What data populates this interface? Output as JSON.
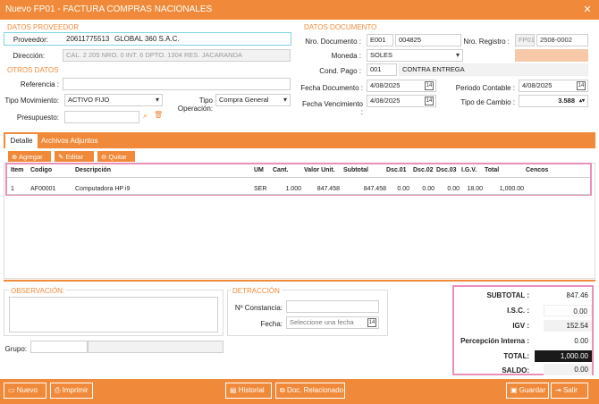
{
  "window": {
    "title": "Nuevo FP01 - FACTURA COMPRAS NACIONALES"
  },
  "proveedor": {
    "section": "DATOS PROVEEDOR",
    "label_proveedor": "Proveedor:",
    "ruc": "20611775513",
    "nombre": "GLOBAL 360 S.A.C.",
    "label_direccion": "Dirección:",
    "direccion": "CAL. 2 205 NRO. 0 INT. 6 DPTO. 1304 RES. JACARANDA"
  },
  "otros": {
    "section": "OTROS DATOS",
    "label_referencia": "Referencia :",
    "referencia": "",
    "label_movimiento": "Tipo Movimiento:",
    "movimiento": "ACTIVO FIJO",
    "label_operacion": "Tipo Operación:",
    "operacion": "Compra General",
    "label_presupuesto": "Presupuesto:",
    "presupuesto": ""
  },
  "documento": {
    "section": "DATOS DOCUMENTO",
    "label_nro": "Nro. Documento :",
    "serie": "E001",
    "numero": "004825",
    "label_registro": "Nro. Registro :",
    "registro_prefix": "FP01",
    "registro": "2508-0002",
    "label_moneda": "Moneda :",
    "moneda": "SOLES",
    "label_cond": "Cond. Pago :",
    "cond_code": "001",
    "cond_desc": "CONTRA ENTREGA",
    "label_fecha": "Fecha Documento :",
    "fecha": "4/08/2025",
    "label_periodo": "Periodo Contable :",
    "periodo": "4/08/2025",
    "label_venc": "Fecha Vencimiento :",
    "venc": "4/08/2025",
    "label_cambio": "Tipo de Cambio :",
    "cambio": "3.588"
  },
  "tabs": [
    "Detalle",
    "Archivos Adjuntos"
  ],
  "toolbar": {
    "agregar": "Agregar",
    "editar": "Editar",
    "quitar": "Quitar"
  },
  "grid": {
    "headers": [
      "Item",
      "Codigo",
      "Descripción",
      "UM",
      "Cant.",
      "Valor Unit.",
      "Subtotal",
      "Dsc.01",
      "Dsc.02",
      "Dsc.03",
      "I.G.V.",
      "Total",
      "Cencos"
    ],
    "rows": [
      [
        "1",
        "AF00001",
        "Computadora HP i9",
        "SER",
        "1.000",
        "847.458",
        "847.458",
        "0.00",
        "0.00",
        "0.00",
        "18.00",
        "1,000.00",
        ""
      ]
    ]
  },
  "observacion": {
    "section": "OBSERVACIÓN:",
    "text": ""
  },
  "grupo": {
    "label": "Grupo:",
    "value": ""
  },
  "detraccion": {
    "section": "DETRACCIÓN",
    "label_constancia": "Nº Constancia:",
    "constancia": "",
    "label_fecha": "Fecha:",
    "fecha_placeholder": "Seleccione una fecha"
  },
  "totales": {
    "label_subtotal": "SUBTOTAL :",
    "subtotal": "847.46",
    "label_isc": "I.S.C. :",
    "isc": "0.00",
    "label_igv": "IGV :",
    "igv": "152.54",
    "label_percepcion": "Percepción Interna :",
    "percepcion": "0.00",
    "label_total": "TOTAL:",
    "total": "1,000.00",
    "label_saldo": "SALDO:",
    "saldo": "0.00"
  },
  "footer": {
    "nuevo": "Nuevo",
    "imprimir": "Imprimir",
    "historial": "Historial",
    "doc_relacionado": "Doc. Relacionado",
    "guardar": "Guardar",
    "salir": "Salir"
  },
  "colors": {
    "accent": "#f08a3a",
    "highlight": "#e891b8",
    "total_bg": "#1a1a1a"
  }
}
